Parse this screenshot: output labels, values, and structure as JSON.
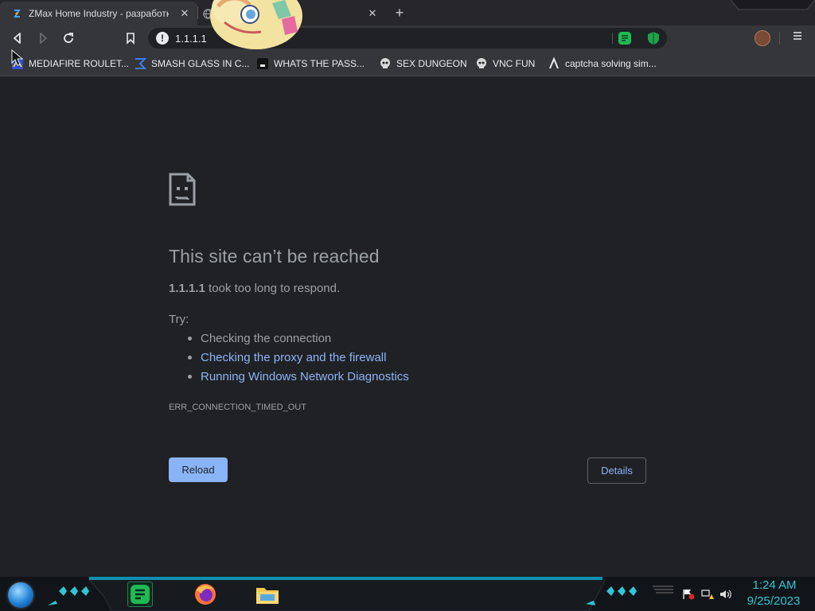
{
  "tabs": [
    {
      "title": "ZMax Home Industry - разработк",
      "active": true,
      "favicon": "zmax-favicon"
    },
    {
      "title": "",
      "active": false,
      "favicon": "globe-icon"
    }
  ],
  "toolbar": {
    "url": "1.1.1.1",
    "security_badge": "!"
  },
  "bookmarks": [
    {
      "label": "MEDIAFIRE ROULET...",
      "icon": "mediafire-icon"
    },
    {
      "label": "SMASH GLASS IN C...",
      "icon": "smash-icon"
    },
    {
      "label": "WHATS THE PASS...",
      "icon": "terminal-icon"
    },
    {
      "label": "SEX DUNGEON",
      "icon": "skull-icon"
    },
    {
      "label": "VNC FUN",
      "icon": "skull-icon"
    },
    {
      "label": "captcha solving sim...",
      "icon": "vercel-icon"
    }
  ],
  "error_page": {
    "title": "This site can’t be reached",
    "host": "1.1.1.1",
    "message": "took too long to respond.",
    "try_label": "Try:",
    "suggestions": [
      {
        "text": "Checking the connection",
        "link": false
      },
      {
        "text": "Checking the proxy and the firewall",
        "link": true
      },
      {
        "text": "Running Windows Network Diagnostics",
        "link": true
      }
    ],
    "error_code": "ERR_CONNECTION_TIMED_OUT",
    "reload_label": "Reload",
    "details_label": "Details"
  },
  "taskbar": {
    "time": "1:24 AM",
    "date": "9/25/2023",
    "apps": [
      "notes-app-icon",
      "firefox-icon",
      "file-explorer-icon"
    ]
  },
  "colors": {
    "page_bg": "#202124",
    "link": "#8ab4f8",
    "text": "#9aa0a6",
    "accent": "#2fc6d6"
  }
}
